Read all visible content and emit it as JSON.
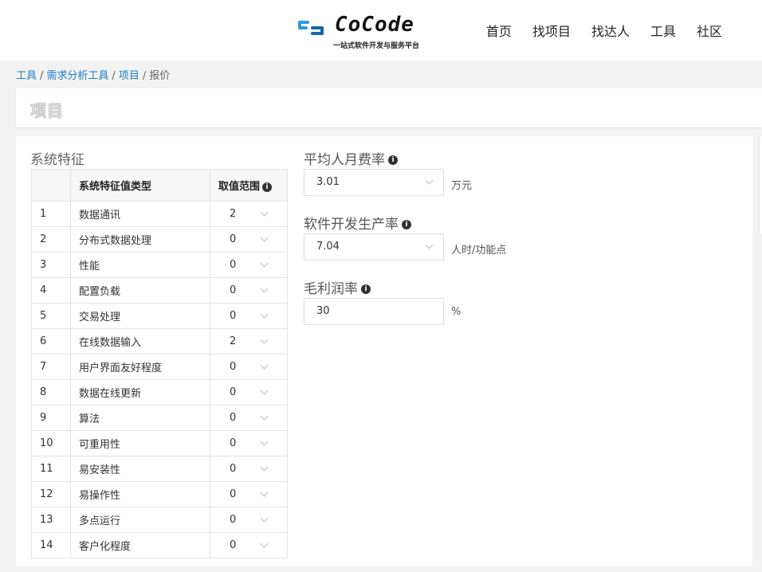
{
  "header": {
    "logo_text": "CoCode",
    "logo_tagline": "一站式软件开发与服务平台",
    "nav": [
      "首页",
      "找项目",
      "找达人",
      "工具",
      "社区"
    ]
  },
  "breadcrumb": {
    "items": [
      "工具",
      "需求分析工具",
      "项目",
      "报价"
    ],
    "separator": "/"
  },
  "page_title": "项目",
  "system_features": {
    "title": "系统特征",
    "columns": [
      "",
      "系统特征值类型",
      "取值范围"
    ],
    "rows": [
      {
        "idx": "1",
        "name": "数据通讯",
        "value": "2"
      },
      {
        "idx": "2",
        "name": "分布式数据处理",
        "value": "0"
      },
      {
        "idx": "3",
        "name": "性能",
        "value": "0"
      },
      {
        "idx": "4",
        "name": "配置负载",
        "value": "0"
      },
      {
        "idx": "5",
        "name": "交易处理",
        "value": "0"
      },
      {
        "idx": "6",
        "name": "在线数据输入",
        "value": "2"
      },
      {
        "idx": "7",
        "name": "用户界面友好程度",
        "value": "0"
      },
      {
        "idx": "8",
        "name": "数据在线更新",
        "value": "0"
      },
      {
        "idx": "9",
        "name": "算法",
        "value": "0"
      },
      {
        "idx": "10",
        "name": "可重用性",
        "value": "0"
      },
      {
        "idx": "11",
        "name": "易安装性",
        "value": "0"
      },
      {
        "idx": "12",
        "name": "易操作性",
        "value": "0"
      },
      {
        "idx": "13",
        "name": "多点运行",
        "value": "0"
      },
      {
        "idx": "14",
        "name": "客户化程度",
        "value": "0"
      }
    ]
  },
  "form": {
    "avg_rate": {
      "label": "平均人月费率",
      "value": "3.01",
      "unit": "万元"
    },
    "productivity": {
      "label": "软件开发生产率",
      "value": "7.04",
      "unit": "人时/功能点"
    },
    "margin": {
      "label": "毛利润率",
      "value": "30",
      "unit": "%"
    }
  },
  "colors": {
    "link": "#1e7ec8",
    "background": "#f2f2f2",
    "logo_accent": "#2a9bdc"
  }
}
